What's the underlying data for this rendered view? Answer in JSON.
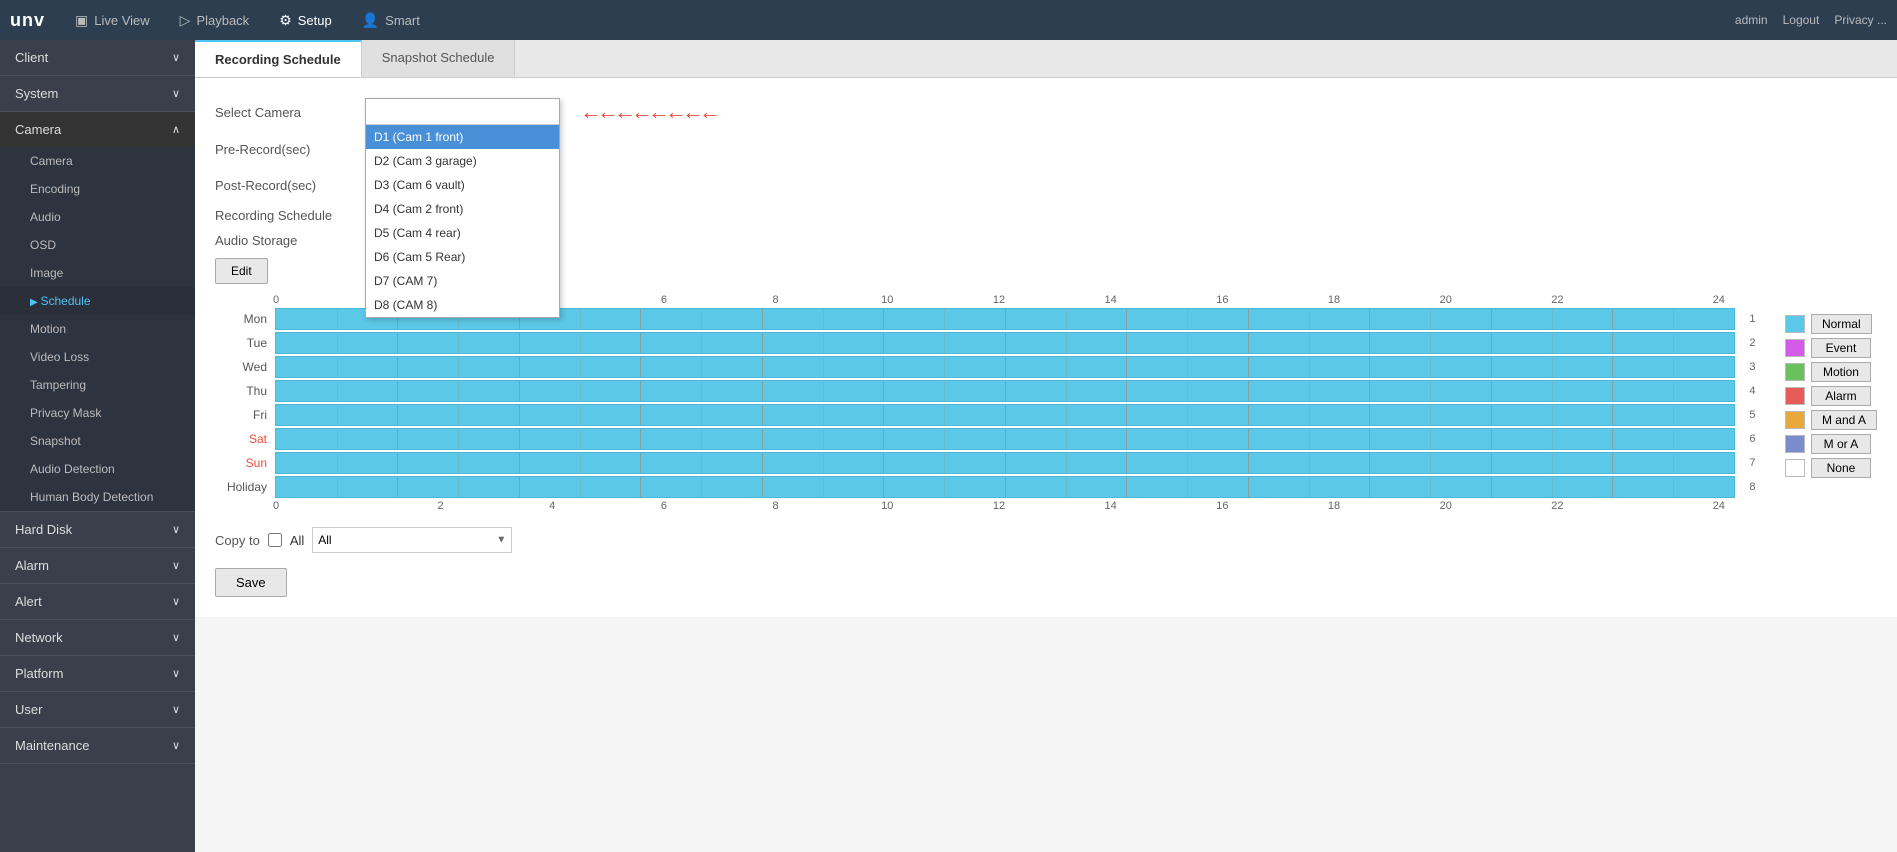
{
  "app": {
    "logo": "unv",
    "top_right": {
      "admin": "admin",
      "logout": "Logout",
      "privacy": "Privacy ..."
    }
  },
  "nav": {
    "items": [
      {
        "id": "live-view",
        "label": "Live View",
        "icon": "▣",
        "active": false
      },
      {
        "id": "playback",
        "label": "Playback",
        "icon": "▷",
        "active": false
      },
      {
        "id": "setup",
        "label": "Setup",
        "icon": "⚙",
        "active": true
      },
      {
        "id": "smart",
        "label": "Smart",
        "icon": "👤",
        "active": false
      }
    ]
  },
  "sidebar": {
    "sections": [
      {
        "id": "client",
        "label": "Client",
        "open": false,
        "items": []
      },
      {
        "id": "system",
        "label": "System",
        "open": false,
        "items": []
      },
      {
        "id": "camera",
        "label": "Camera",
        "open": true,
        "items": [
          {
            "id": "camera",
            "label": "Camera",
            "active": false
          },
          {
            "id": "encoding",
            "label": "Encoding",
            "active": false
          },
          {
            "id": "audio",
            "label": "Audio",
            "active": false
          },
          {
            "id": "osd",
            "label": "OSD",
            "active": false
          },
          {
            "id": "image",
            "label": "Image",
            "active": false
          },
          {
            "id": "schedule",
            "label": "Schedule",
            "active": true
          },
          {
            "id": "motion",
            "label": "Motion",
            "active": false
          },
          {
            "id": "video-loss",
            "label": "Video Loss",
            "active": false
          },
          {
            "id": "tampering",
            "label": "Tampering",
            "active": false
          },
          {
            "id": "privacy-mask",
            "label": "Privacy Mask",
            "active": false
          },
          {
            "id": "snapshot",
            "label": "Snapshot",
            "active": false
          },
          {
            "id": "audio-detection",
            "label": "Audio Detection",
            "active": false
          },
          {
            "id": "human-body-detection",
            "label": "Human Body Detection",
            "active": false
          }
        ]
      },
      {
        "id": "hard-disk",
        "label": "Hard Disk",
        "open": false,
        "items": []
      },
      {
        "id": "alarm",
        "label": "Alarm",
        "open": false,
        "items": []
      },
      {
        "id": "alert",
        "label": "Alert",
        "open": false,
        "items": []
      },
      {
        "id": "network",
        "label": "Network",
        "open": false,
        "items": []
      },
      {
        "id": "platform",
        "label": "Platform",
        "open": false,
        "items": []
      },
      {
        "id": "user",
        "label": "User",
        "open": false,
        "items": []
      },
      {
        "id": "maintenance",
        "label": "Maintenance",
        "open": false,
        "items": []
      }
    ]
  },
  "tabs": [
    {
      "id": "recording-schedule",
      "label": "Recording Schedule",
      "active": true
    },
    {
      "id": "snapshot-schedule",
      "label": "Snapshot Schedule",
      "active": false
    }
  ],
  "form": {
    "select_camera_label": "Select Camera",
    "pre_record_label": "Pre-Record(sec)",
    "post_record_label": "Post-Record(sec)",
    "recording_schedule_label": "Recording Schedule",
    "audio_storage_label": "Audio Storage",
    "selected_camera": "D1 (Cam 1 front)",
    "camera_options": [
      {
        "value": "D1",
        "label": "D1 (Cam 1 front)",
        "selected": true
      },
      {
        "value": "D2",
        "label": "D2 (Cam 3 garage)",
        "selected": false
      },
      {
        "value": "D3",
        "label": "D3 (Cam 6 vault)",
        "selected": false
      },
      {
        "value": "D4",
        "label": "D4 (Cam 2 front)",
        "selected": false
      },
      {
        "value": "D5",
        "label": "D5 (Cam 4 rear)",
        "selected": false
      },
      {
        "value": "D6",
        "label": "D6 (Cam 5 Rear)",
        "selected": false
      },
      {
        "value": "D7",
        "label": "D7 (CAM 7)",
        "selected": false
      },
      {
        "value": "D8",
        "label": "D8 (CAM 8)",
        "selected": false
      }
    ]
  },
  "schedule": {
    "edit_btn": "Edit",
    "hour_labels": [
      "0",
      "2",
      "4",
      "6",
      "8",
      "10",
      "12",
      "14",
      "16",
      "18",
      "20",
      "22",
      "24"
    ],
    "days": [
      {
        "label": "Mon",
        "number": "1",
        "weekend": false
      },
      {
        "label": "Tue",
        "number": "2",
        "weekend": false
      },
      {
        "label": "Wed",
        "number": "3",
        "weekend": false
      },
      {
        "label": "Thu",
        "number": "4",
        "weekend": false
      },
      {
        "label": "Fri",
        "number": "5",
        "weekend": false
      },
      {
        "label": "Sat",
        "number": "6",
        "weekend": true
      },
      {
        "label": "Sun",
        "number": "7",
        "weekend": true
      },
      {
        "label": "Holiday",
        "number": "8",
        "weekend": false
      }
    ],
    "legend": [
      {
        "id": "normal",
        "color": "#5bc8e8",
        "label": "Normal"
      },
      {
        "id": "event",
        "color": "#d45be8",
        "label": "Event"
      },
      {
        "id": "motion",
        "color": "#6abf5e",
        "label": "Motion"
      },
      {
        "id": "alarm",
        "color": "#e85b5b",
        "label": "Alarm"
      },
      {
        "id": "m-and-a",
        "color": "#e8a83c",
        "label": "M and A"
      },
      {
        "id": "m-or-a",
        "color": "#7a8ccc",
        "label": "M or A"
      },
      {
        "id": "none",
        "color": "#ffffff",
        "label": "None"
      }
    ]
  },
  "copy": {
    "label": "Copy to",
    "all_label": "All",
    "dropdown_label": "All"
  },
  "save_btn": "Save"
}
